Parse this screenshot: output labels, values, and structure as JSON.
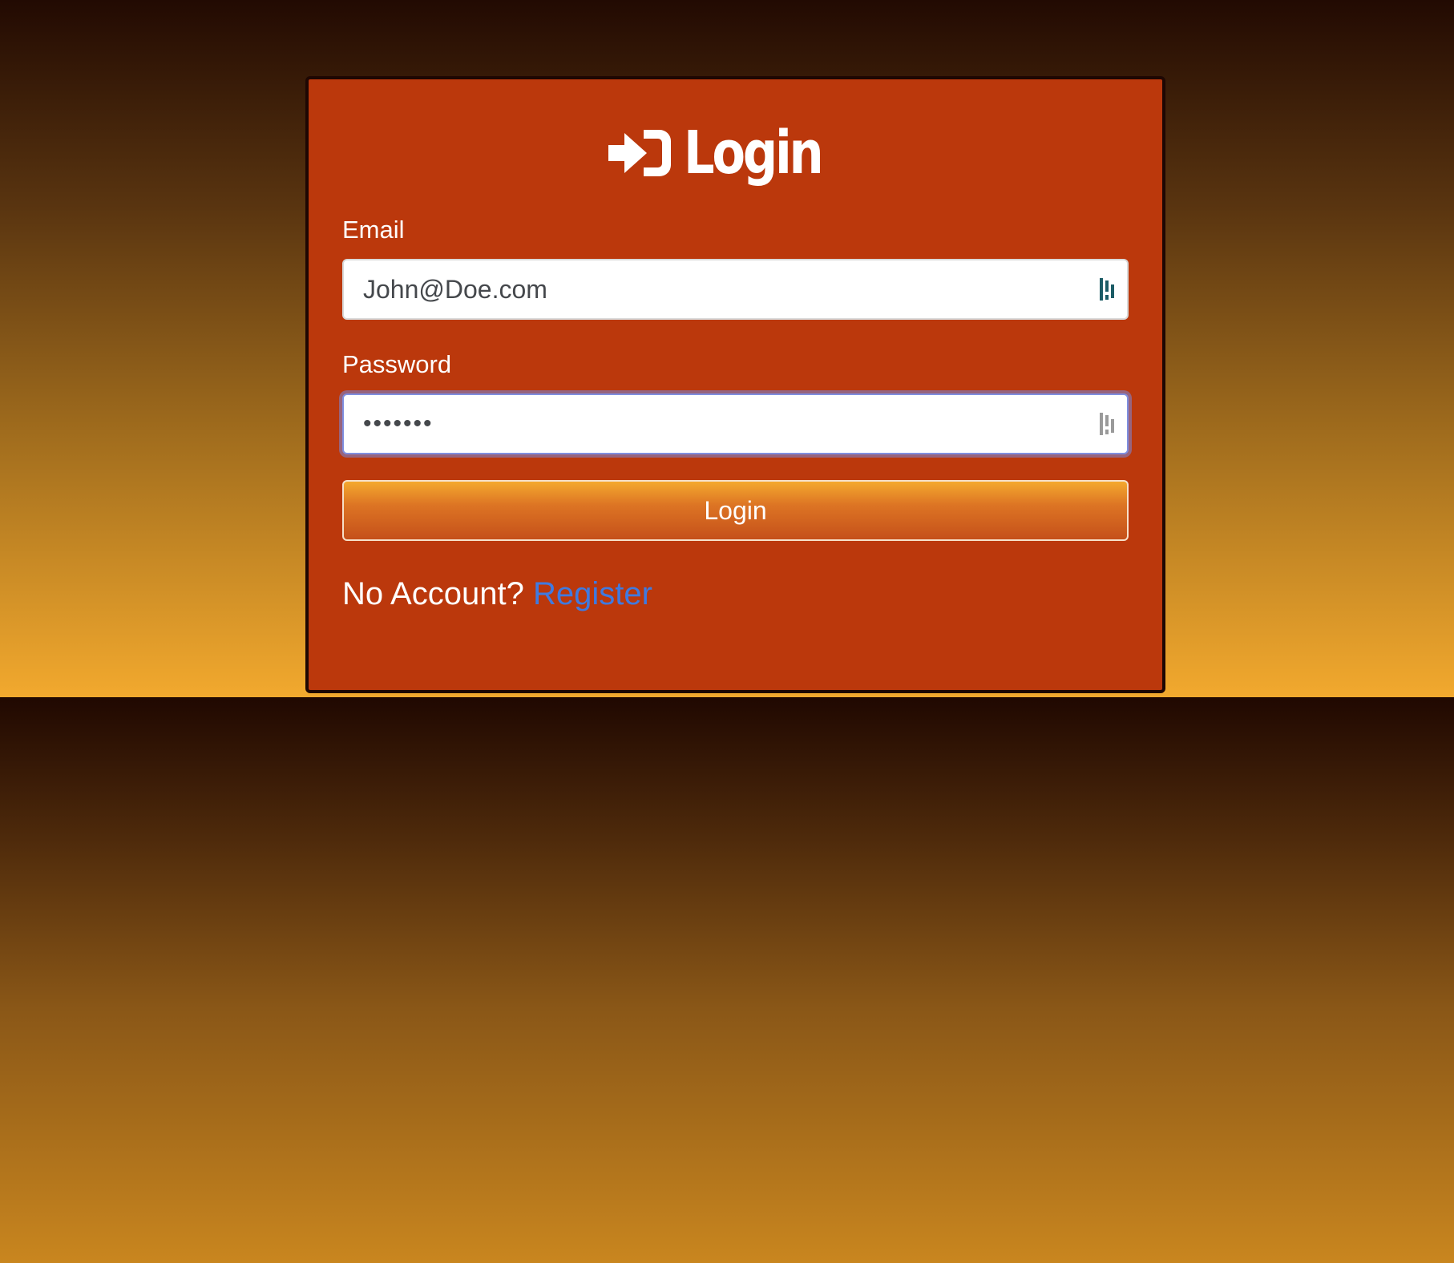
{
  "page": {
    "title": "Login",
    "title_icon": "sign-in-icon"
  },
  "form": {
    "email": {
      "label": "Email",
      "value": "John@Doe.com"
    },
    "password": {
      "label": "Password",
      "value": "•••••••"
    },
    "submit_label": "Login",
    "field_icon": "password-manager-icon"
  },
  "footer": {
    "prompt": "No Account?",
    "register_label": "Register"
  },
  "colors": {
    "card": "#bb380c",
    "link": "#3f7ae0",
    "button_top": "#f4a92e",
    "button_bottom": "#c5501a"
  }
}
